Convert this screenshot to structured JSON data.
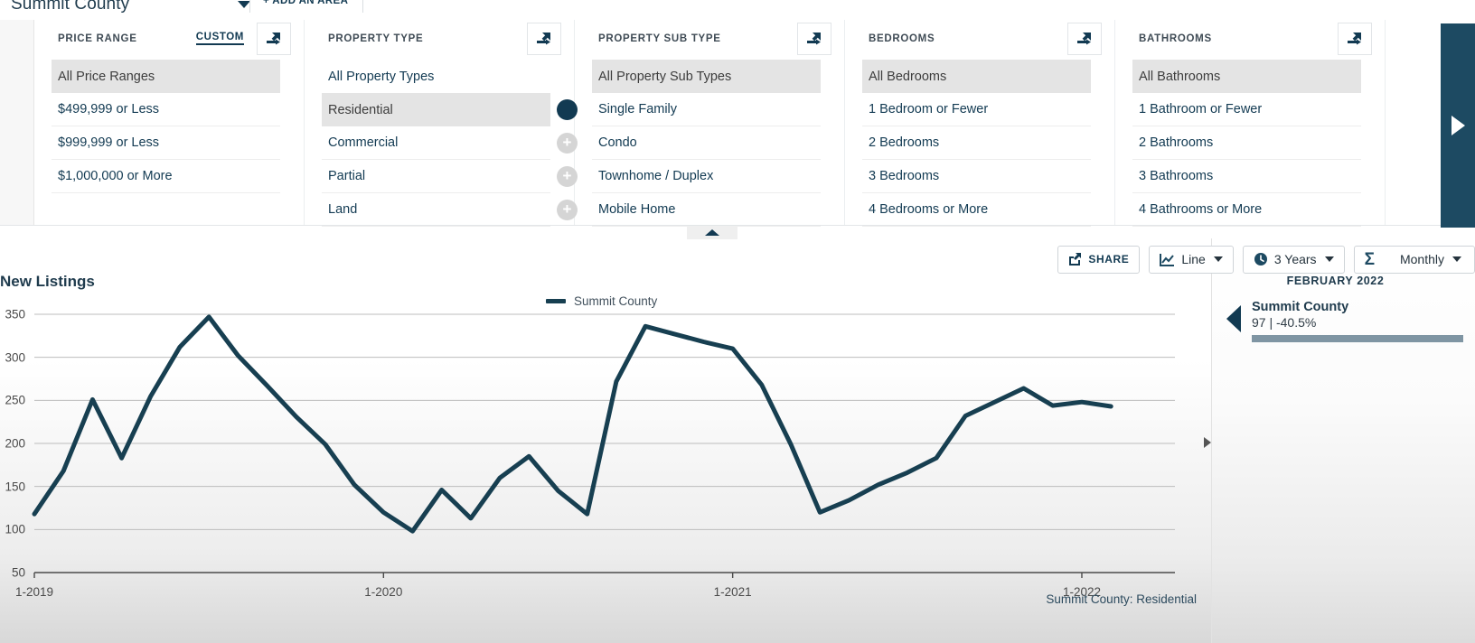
{
  "area_bar": {
    "area_name": "Summit County",
    "caret_icon": "chevron-down-icon",
    "close_icon": "close-icon",
    "add_area_label": "+ ADD AN AREA"
  },
  "filters": {
    "columns": [
      {
        "title": "PRICE RANGE",
        "custom_label": "CUSTOM",
        "expand_icon": "expand-arrow-icon",
        "items": [
          {
            "label": "All Price Ranges",
            "selected": true,
            "control": "none"
          },
          {
            "label": "$499,999 or Less",
            "selected": false,
            "control": "none"
          },
          {
            "label": "$999,999 or Less",
            "selected": false,
            "control": "none"
          },
          {
            "label": "$1,000,000 or More",
            "selected": false,
            "control": "none"
          }
        ]
      },
      {
        "title": "PROPERTY TYPE",
        "custom_label": "",
        "expand_icon": "expand-arrow-icon",
        "items": [
          {
            "label": "All Property Types",
            "selected": false,
            "control": "none"
          },
          {
            "label": "Residential",
            "selected": true,
            "control": "dot"
          },
          {
            "label": "Commercial",
            "selected": false,
            "control": "plus"
          },
          {
            "label": "Partial",
            "selected": false,
            "control": "plus"
          },
          {
            "label": "Land",
            "selected": false,
            "control": "plus"
          }
        ]
      },
      {
        "title": "PROPERTY SUB TYPE",
        "custom_label": "",
        "expand_icon": "expand-arrow-icon",
        "items": [
          {
            "label": "All Property Sub Types",
            "selected": true,
            "control": "none"
          },
          {
            "label": "Single Family",
            "selected": false,
            "control": "none"
          },
          {
            "label": "Condo",
            "selected": false,
            "control": "none"
          },
          {
            "label": "Townhome / Duplex",
            "selected": false,
            "control": "none"
          },
          {
            "label": "Mobile Home",
            "selected": false,
            "control": "none"
          }
        ]
      },
      {
        "title": "BEDROOMS",
        "custom_label": "",
        "expand_icon": "expand-arrow-icon",
        "items": [
          {
            "label": "All Bedrooms",
            "selected": true,
            "control": "none"
          },
          {
            "label": "1 Bedroom or Fewer",
            "selected": false,
            "control": "none"
          },
          {
            "label": "2 Bedrooms",
            "selected": false,
            "control": "none"
          },
          {
            "label": "3 Bedrooms",
            "selected": false,
            "control": "none"
          },
          {
            "label": "4 Bedrooms or More",
            "selected": false,
            "control": "none"
          }
        ]
      },
      {
        "title": "BATHROOMS",
        "custom_label": "",
        "expand_icon": "expand-arrow-icon",
        "items": [
          {
            "label": "All Bathrooms",
            "selected": true,
            "control": "none"
          },
          {
            "label": "1 Bathroom or Fewer",
            "selected": false,
            "control": "none"
          },
          {
            "label": "2 Bathrooms",
            "selected": false,
            "control": "none"
          },
          {
            "label": "3 Bathrooms",
            "selected": false,
            "control": "none"
          },
          {
            "label": "4 Bathrooms or More",
            "selected": false,
            "control": "none"
          }
        ]
      }
    ],
    "next_panel_icon": "play-triangle-icon",
    "collapse_icon": "triangle-up-icon"
  },
  "toolbar": {
    "share_label": "SHARE",
    "share_icon": "share-icon",
    "chart_type_label": "Line",
    "chart_type_icon": "line-chart-icon",
    "period_label": "3 Years",
    "period_icon": "clock-icon",
    "aggregate_label": "Monthly",
    "aggregate_icon": "sigma-icon"
  },
  "detail_panel": {
    "month": "FEBRUARY 2022",
    "series_name": "Summit County",
    "value_text": "97 | -40.5%",
    "bar_color": "#7f95a3",
    "pointer_icon": "left-pointer-icon"
  },
  "colors": {
    "line": "#173f51",
    "accent": "#1d4a62",
    "selected_row": "#e4e4e4"
  },
  "chart_data": {
    "type": "line",
    "title": "New Listings",
    "xlabel": "",
    "ylabel": "",
    "ylim": [
      50,
      350
    ],
    "yticks": [
      50,
      100,
      150,
      200,
      250,
      300,
      350
    ],
    "grid": true,
    "legend": [
      "Summit County"
    ],
    "legend_position": "top-center",
    "footer": "Summit County: Residential",
    "xtick_labels": [
      "1-2019",
      "1-2020",
      "1-2021",
      "1-2022"
    ],
    "xtick_indices": [
      0,
      12,
      24,
      36
    ],
    "x": [
      "1-2019",
      "2-2019",
      "3-2019",
      "4-2019",
      "5-2019",
      "6-2019",
      "7-2019",
      "8-2019",
      "9-2019",
      "10-2019",
      "11-2019",
      "12-2019",
      "1-2020",
      "2-2020",
      "3-2020",
      "4-2020",
      "5-2020",
      "6-2020",
      "7-2020",
      "8-2020",
      "9-2020",
      "10-2020",
      "11-2020",
      "12-2020",
      "1-2021",
      "2-2021",
      "3-2021",
      "4-2021",
      "5-2021",
      "6-2021",
      "7-2021",
      "8-2021",
      "9-2021",
      "10-2021",
      "11-2021",
      "12-2021",
      "1-2022",
      "2-2022"
    ],
    "series": [
      {
        "name": "Summit County",
        "color": "#173f51",
        "values": [
          118,
          168,
          251,
          183,
          255,
          312,
          347,
          302,
          267,
          231,
          199,
          152,
          120,
          98,
          146,
          113,
          160,
          185,
          145,
          118,
          272,
          336,
          327,
          318,
          310,
          268,
          199,
          120,
          134,
          152,
          166,
          183,
          232,
          248,
          264,
          244,
          248,
          243
        ]
      }
    ],
    "highlight_point": {
      "x": "2-2022",
      "value": 97,
      "change": "-40.5%"
    }
  }
}
